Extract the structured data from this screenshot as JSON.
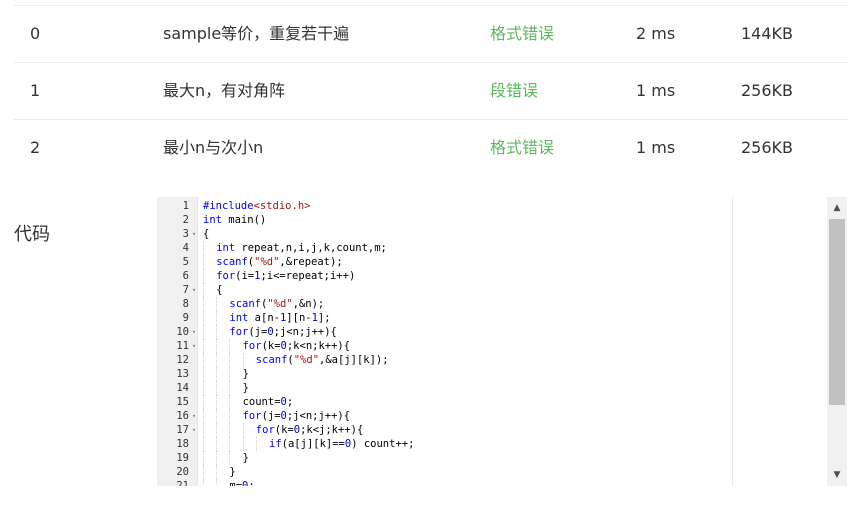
{
  "results": [
    {
      "index": "0",
      "name": "sample等价，重复若干遍",
      "status": "格式错误",
      "time": "2 ms",
      "memory": "144KB"
    },
    {
      "index": "1",
      "name": "最大n，有对角阵",
      "status": "段错误",
      "time": "1 ms",
      "memory": "256KB"
    },
    {
      "index": "2",
      "name": "最小n与次小n",
      "status": "格式错误",
      "time": "1 ms",
      "memory": "256KB"
    }
  ],
  "colors": {
    "status": "#5cb85c"
  },
  "code_section": {
    "label": "代码",
    "lines": [
      {
        "n": "1",
        "fold": "",
        "indent": 0,
        "tokens": [
          [
            "kw",
            "#include"
          ],
          [
            "inc",
            "<stdio.h>"
          ]
        ]
      },
      {
        "n": "2",
        "fold": "",
        "indent": 0,
        "tokens": [
          [
            "kw",
            "int"
          ],
          [
            "plain",
            " main()"
          ]
        ]
      },
      {
        "n": "3",
        "fold": "▾",
        "indent": 0,
        "tokens": [
          [
            "plain",
            "{"
          ]
        ]
      },
      {
        "n": "4",
        "fold": "",
        "indent": 1,
        "tokens": [
          [
            "kw",
            "int"
          ],
          [
            "plain",
            " repeat,n,i,j,k,count,m;"
          ]
        ]
      },
      {
        "n": "5",
        "fold": "",
        "indent": 1,
        "tokens": [
          [
            "kw",
            "scanf"
          ],
          [
            "plain",
            "("
          ],
          [
            "str",
            "\"%d\""
          ],
          [
            "plain",
            ",&repeat);"
          ]
        ]
      },
      {
        "n": "6",
        "fold": "",
        "indent": 1,
        "tokens": [
          [
            "kw",
            "for"
          ],
          [
            "plain",
            "(i="
          ],
          [
            "num",
            "1"
          ],
          [
            "plain",
            ";i<=repeat;i++)"
          ]
        ]
      },
      {
        "n": "7",
        "fold": "▾",
        "indent": 1,
        "tokens": [
          [
            "plain",
            "{"
          ]
        ]
      },
      {
        "n": "8",
        "fold": "",
        "indent": 2,
        "tokens": [
          [
            "kw",
            "scanf"
          ],
          [
            "plain",
            "("
          ],
          [
            "str",
            "\"%d\""
          ],
          [
            "plain",
            ",&n);"
          ]
        ]
      },
      {
        "n": "9",
        "fold": "",
        "indent": 2,
        "tokens": [
          [
            "kw",
            "int"
          ],
          [
            "plain",
            " a[n-"
          ],
          [
            "num",
            "1"
          ],
          [
            "plain",
            "][n-"
          ],
          [
            "num",
            "1"
          ],
          [
            "plain",
            "];"
          ]
        ]
      },
      {
        "n": "10",
        "fold": "▾",
        "indent": 2,
        "tokens": [
          [
            "kw",
            "for"
          ],
          [
            "plain",
            "(j="
          ],
          [
            "num",
            "0"
          ],
          [
            "plain",
            ";j<n;j++){"
          ]
        ]
      },
      {
        "n": "11",
        "fold": "▾",
        "indent": 3,
        "tokens": [
          [
            "kw",
            "for"
          ],
          [
            "plain",
            "(k="
          ],
          [
            "num",
            "0"
          ],
          [
            "plain",
            ";k<n;k++){"
          ]
        ]
      },
      {
        "n": "12",
        "fold": "",
        "indent": 4,
        "tokens": [
          [
            "kw",
            "scanf"
          ],
          [
            "plain",
            "("
          ],
          [
            "str",
            "\"%d\""
          ],
          [
            "plain",
            ",&a[j][k]);"
          ]
        ]
      },
      {
        "n": "13",
        "fold": "",
        "indent": 3,
        "tokens": [
          [
            "plain",
            "}"
          ]
        ]
      },
      {
        "n": "14",
        "fold": "",
        "indent": 3,
        "tokens": [
          [
            "plain",
            "}"
          ]
        ]
      },
      {
        "n": "15",
        "fold": "",
        "indent": 3,
        "tokens": [
          [
            "plain",
            "count="
          ],
          [
            "num",
            "0"
          ],
          [
            "plain",
            ";"
          ]
        ]
      },
      {
        "n": "16",
        "fold": "▾",
        "indent": 3,
        "tokens": [
          [
            "kw",
            "for"
          ],
          [
            "plain",
            "(j="
          ],
          [
            "num",
            "0"
          ],
          [
            "plain",
            ";j<n;j++){"
          ]
        ]
      },
      {
        "n": "17",
        "fold": "▾",
        "indent": 4,
        "tokens": [
          [
            "kw",
            "for"
          ],
          [
            "plain",
            "(k="
          ],
          [
            "num",
            "0"
          ],
          [
            "plain",
            ";k<j;k++){"
          ]
        ]
      },
      {
        "n": "18",
        "fold": "",
        "indent": 5,
        "tokens": [
          [
            "kw",
            "if"
          ],
          [
            "plain",
            "(a[j][k]=="
          ],
          [
            "num",
            "0"
          ],
          [
            "plain",
            ") count++;"
          ]
        ]
      },
      {
        "n": "19",
        "fold": "",
        "indent": 3,
        "tokens": [
          [
            "plain",
            "}"
          ]
        ]
      },
      {
        "n": "20",
        "fold": "",
        "indent": 2,
        "tokens": [
          [
            "plain",
            "}"
          ]
        ]
      },
      {
        "n": "21",
        "fold": "",
        "indent": 2,
        "tokens": [
          [
            "plain",
            "m="
          ],
          [
            "num",
            "0"
          ],
          [
            "plain",
            ";"
          ]
        ]
      }
    ]
  },
  "scrollbar": {
    "up_icon": "arrow-up-icon",
    "down_icon": "arrow-down-icon"
  }
}
